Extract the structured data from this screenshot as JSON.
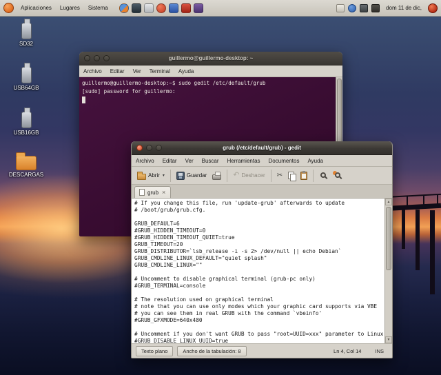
{
  "colors": {
    "panel_bg": "#d6d2ca",
    "terminal_purple": "#3a0d33",
    "titlebar_dark": "#3c3935",
    "close_button_orange": "#e96b4c",
    "folder_orange": "#d9822b"
  },
  "glyphs": {
    "dropdown": "▾",
    "undo": "↶",
    "cut": "✂",
    "close_tab": "×",
    "scroll_up": "▲",
    "scroll_down": "▼"
  },
  "panel": {
    "menus": [
      "Aplicaciones",
      "Lugares",
      "Sistema"
    ],
    "clock": "dom 11 de dic,"
  },
  "desktop": {
    "icons": [
      {
        "label": "SD32"
      },
      {
        "label": "USB64GB"
      },
      {
        "label": "USB16GB"
      },
      {
        "label": "DESCARGAS"
      }
    ]
  },
  "terminal": {
    "title": "guillermo@guillermo-desktop: ~",
    "menu": [
      "Archivo",
      "Editar",
      "Ver",
      "Terminal",
      "Ayuda"
    ],
    "lines": [
      "guillermo@guillermo-desktop:~$ sudo gedit /etc/default/grub",
      "[sudo] password for guillermo: "
    ]
  },
  "gedit": {
    "title": "grub (/etc/default/grub) - gedit",
    "menu": [
      "Archivo",
      "Editar",
      "Ver",
      "Buscar",
      "Herramientas",
      "Documentos",
      "Ayuda"
    ],
    "toolbar": {
      "open": "Abrir",
      "save": "Guardar",
      "undo": "Deshacer"
    },
    "tab": {
      "label": "grub"
    },
    "editor_lines": [
      "# If you change this file, run 'update-grub' afterwards to update",
      "# /boot/grub/grub.cfg.",
      "",
      "GRUB_DEFAULT=6",
      "#GRUB_HIDDEN_TIMEOUT=0",
      "#GRUB_HIDDEN_TIMEOUT_QUIET=true",
      "GRUB_TIMEOUT=20",
      "GRUB_DISTRIBUTOR=`lsb_release -i -s 2> /dev/null || echo Debian`",
      "GRUB_CMDLINE_LINUX_DEFAULT=\"quiet splash\"",
      "GRUB_CMDLINE_LINUX=\"\"",
      "",
      "# Uncomment to disable graphical terminal (grub-pc only)",
      "#GRUB_TERMINAL=console",
      "",
      "# The resolution used on graphical terminal",
      "# note that you can use only modes which your graphic card supports via VBE",
      "# you can see them in real GRUB with the command `vbeinfo'",
      "#GRUB_GFXMODE=640x480",
      "",
      "# Uncomment if you don't want GRUB to pass \"root=UUID=xxx\" parameter to Linux",
      "#GRUB_DISABLE_LINUX_UUID=true"
    ],
    "statusbar": {
      "doc_type": "Texto plano",
      "tab_width": "Ancho de la tabulación: 8",
      "cursor_pos": "Ln 4, Col 14",
      "mode": "INS"
    }
  }
}
